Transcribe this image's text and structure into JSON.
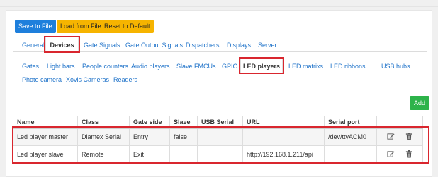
{
  "toolbar": {
    "save_label": "Save to File",
    "load_label": "Load from File",
    "reset_label": "Reset to Default"
  },
  "main_tabs": [
    "General",
    "Devices",
    "Gate Signals",
    "Gate Output Signals",
    "Dispatchers",
    "Displays",
    "Server"
  ],
  "sub_tabs": [
    "Gates",
    "Light bars",
    "People counters",
    "Audio players",
    "Slave FMCUs",
    "GPIO",
    "LED players",
    "LED matrixs",
    "LED ribbons",
    "USB hubs",
    "Photo camera",
    "Xovis Cameras",
    "Readers"
  ],
  "add_label": "Add",
  "table": {
    "headers": [
      "Name",
      "Class",
      "Gate side",
      "Slave",
      "USB Serial",
      "URL",
      "Serial port",
      ""
    ],
    "rows": [
      [
        "Led player master",
        "Diamex Serial",
        "Entry",
        "false",
        "",
        "",
        "/dev/ttyACM0"
      ],
      [
        "Led player slave",
        "Remote",
        "Exit",
        "",
        "",
        "http://192.168.1.211/api",
        ""
      ]
    ]
  },
  "icons": {
    "edit": "edit-icon",
    "delete": "trash-icon"
  },
  "colors": {
    "primary": "#1e7fdc",
    "warning": "#f6b400",
    "success": "#2db34a",
    "link": "#1e72c9",
    "highlight": "#d9262e"
  }
}
